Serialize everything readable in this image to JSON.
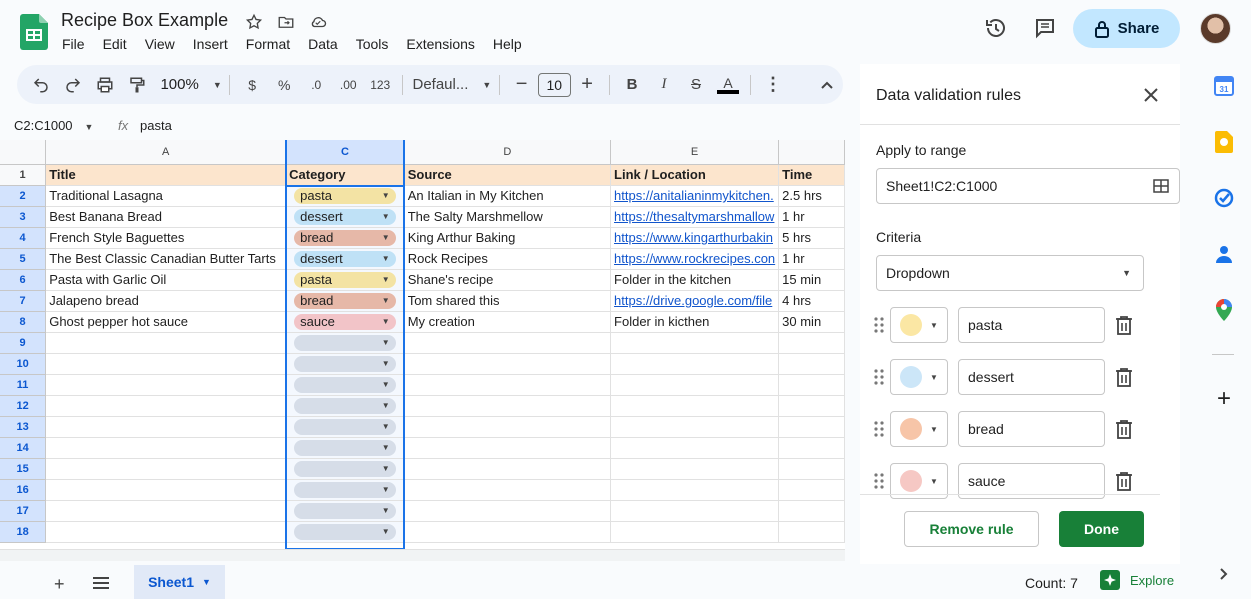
{
  "doc": {
    "title": "Recipe Box Example"
  },
  "menu": [
    "File",
    "Edit",
    "View",
    "Insert",
    "Format",
    "Data",
    "Tools",
    "Extensions",
    "Help"
  ],
  "header": {
    "share_label": "Share"
  },
  "toolbar": {
    "zoom": "100%",
    "currency": "$",
    "percent": "%",
    "dec_decrease": ".0",
    "dec_increase": ".00",
    "number_format": "123",
    "font": "Defaul...",
    "font_size": "10"
  },
  "formula": {
    "name_box": "C2:C1000",
    "fx": "fx",
    "value": "pasta"
  },
  "grid": {
    "columns": [
      "A",
      "C",
      "D",
      "E"
    ],
    "row_numbers": [
      "1",
      "2",
      "3",
      "4",
      "5",
      "6",
      "7",
      "8",
      "9",
      "10",
      "11",
      "12",
      "13",
      "14",
      "15",
      "16",
      "17",
      "18"
    ],
    "headers": {
      "title": "Title",
      "category": "Category",
      "source": "Source",
      "link": "Link / Location",
      "time": "Time"
    },
    "rows": [
      {
        "title": "Traditional Lasagna",
        "category": "pasta",
        "source": "An Italian in My Kitchen",
        "link": "https://anitalianinmykitchen.",
        "is_link": true,
        "time": "2.5 hrs"
      },
      {
        "title": "Best Banana Bread",
        "category": "dessert",
        "source": "The Salty Marshmellow",
        "link": "https://thesaltymarshmallow",
        "is_link": true,
        "time": "1 hr"
      },
      {
        "title": "French Style Baguettes",
        "category": "bread",
        "source": "King Arthur Baking",
        "link": "https://www.kingarthurbakin",
        "is_link": true,
        "time": "5 hrs"
      },
      {
        "title": "The Best Classic Canadian Butter Tarts",
        "category": "dessert",
        "source": "Rock Recipes",
        "link": "https://www.rockrecipes.con",
        "is_link": true,
        "time": "1 hr"
      },
      {
        "title": "Pasta with Garlic Oil",
        "category": "pasta",
        "source": "Shane's recipe",
        "link": "Folder in the kitchen",
        "is_link": false,
        "time": "15 min"
      },
      {
        "title": "Jalapeno bread",
        "category": "bread",
        "source": "Tom shared this",
        "link": "https://drive.google.com/file",
        "is_link": true,
        "time": "4 hrs"
      },
      {
        "title": "Ghost pepper hot sauce",
        "category": "sauce",
        "source": "My creation",
        "link": "Folder in kicthen",
        "is_link": false,
        "time": "30 min"
      }
    ]
  },
  "colors": {
    "pasta": "#f3e3a4",
    "dessert": "#bfe1f6",
    "bread": "#e6b8a8",
    "sauce": "#f2c4c8",
    "accent": "#1a73e8",
    "done": "#188038"
  },
  "bottom": {
    "sheet_tab": "Sheet1",
    "count": "Count: 7",
    "explore": "Explore"
  },
  "panel": {
    "title": "Data validation rules",
    "apply_label": "Apply to range",
    "range": "Sheet1!C2:C1000",
    "criteria_label": "Criteria",
    "criteria": "Dropdown",
    "options": [
      {
        "label": "pasta",
        "color": "#fbe7a4"
      },
      {
        "label": "dessert",
        "color": "#cce6f8"
      },
      {
        "label": "bread",
        "color": "#f7c5a8"
      },
      {
        "label": "sauce",
        "color": "#f6c8c4"
      }
    ],
    "remove_label": "Remove rule",
    "done_label": "Done"
  }
}
